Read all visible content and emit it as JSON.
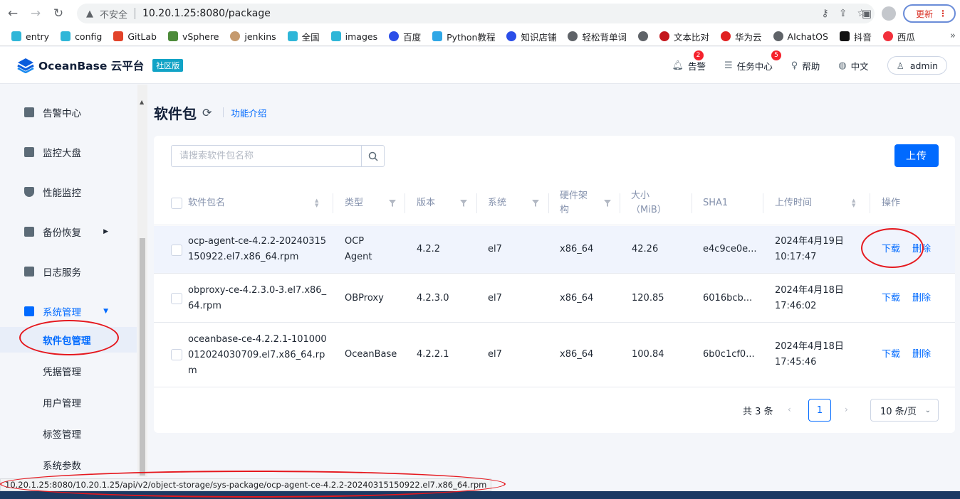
{
  "browser": {
    "security_label": "不安全",
    "url": "10.20.1.25:8080/package",
    "update_label": "更新",
    "bookmarks": [
      "entry",
      "config",
      "GitLab",
      "vSphere",
      "jenkins",
      "全国",
      "images",
      "百度",
      "Python教程",
      "知识店铺",
      "轻松背单词",
      "",
      "文本比对",
      "华为云",
      "AIchatOS",
      "抖音",
      "西瓜"
    ],
    "bookmarks_more": "»",
    "status_url": "10.20.1.25:8080/10.20.1.25/api/v2/object-storage/sys-package/ocp-agent-ce-4.2.2-20240315150922.el7.x86_64.rpm"
  },
  "header": {
    "brand": "OceanBase 云平台",
    "edition": "社区版",
    "alerts_label": "告警",
    "alerts_count": "2",
    "tasks_label": "任务中心",
    "tasks_count": "5",
    "help_label": "帮助",
    "lang_label": "中文",
    "user_label": "admin"
  },
  "sidebar": {
    "items": [
      {
        "label": "告警中心"
      },
      {
        "label": "监控大盘"
      },
      {
        "label": "性能监控"
      },
      {
        "label": "备份恢复"
      },
      {
        "label": "日志服务"
      },
      {
        "label": "系统管理"
      }
    ],
    "sub_items": [
      {
        "label": "软件包管理"
      },
      {
        "label": "凭据管理"
      },
      {
        "label": "用户管理"
      },
      {
        "label": "标签管理"
      },
      {
        "label": "系统参数"
      }
    ]
  },
  "page": {
    "title": "软件包",
    "intro_link": "功能介绍",
    "search_placeholder": "请搜索软件包名称",
    "upload_label": "上传"
  },
  "table": {
    "headers": {
      "name": "软件包名",
      "type": "类型",
      "version": "版本",
      "os": "系统",
      "arch_l1": "硬件架",
      "arch_l2": "构",
      "size_l1": "大小",
      "size_l2": "（MiB）",
      "sha1": "SHA1",
      "upload_time": "上传时间",
      "actions": "操作"
    },
    "rows": [
      {
        "name_l1": "ocp-agent-ce-4.2.2-20240315",
        "name_l2": "150922.el7.x86_64.rpm",
        "name_l3": "",
        "type_l1": "OCP",
        "type_l2": "Agent",
        "version": "4.2.2",
        "os": "el7",
        "arch": "x86_64",
        "size": "42.26",
        "sha1": "e4c9ce0e...",
        "date": "2024年4月19日",
        "time": "10:17:47",
        "download": "下载",
        "delete": "删除"
      },
      {
        "name_l1": "obproxy-ce-4.2.3.0-3.el7.x86_",
        "name_l2": "64.rpm",
        "name_l3": "",
        "type_l1": "OBProxy",
        "type_l2": "",
        "version": "4.2.3.0",
        "os": "el7",
        "arch": "x86_64",
        "size": "120.85",
        "sha1": "6016bcb...",
        "date": "2024年4月18日",
        "time": "17:46:02",
        "download": "下载",
        "delete": "删除"
      },
      {
        "name_l1": "oceanbase-ce-4.2.2.1-101000",
        "name_l2": "012024030709.el7.x86_64.rp",
        "name_l3": "m",
        "type_l1": "OceanBase",
        "type_l2": "",
        "version": "4.2.2.1",
        "os": "el7",
        "arch": "x86_64",
        "size": "100.84",
        "sha1": "6b0c1cf0...",
        "date": "2024年4月18日",
        "time": "17:45:46",
        "download": "下载",
        "delete": "删除"
      }
    ]
  },
  "pagination": {
    "total": "共 3 条",
    "current": "1",
    "page_size": "10 条/页"
  },
  "colors": {
    "primary": "#006aff",
    "annotation": "#e5181e"
  }
}
